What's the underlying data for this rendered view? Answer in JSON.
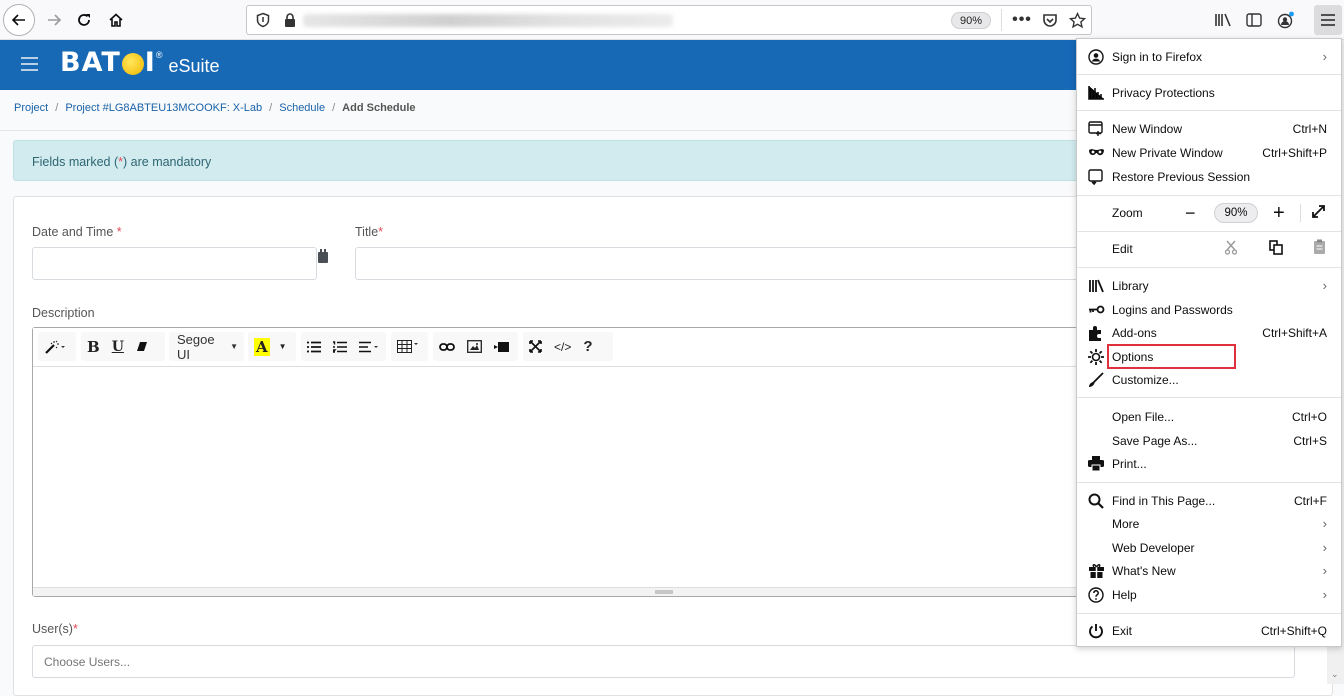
{
  "browser": {
    "zoom_badge": "90%",
    "icons": [
      "back-icon",
      "forward-icon",
      "reload-icon",
      "home-icon",
      "tracking-shield-icon",
      "lock-icon",
      "page-actions-icon",
      "pocket-icon",
      "bookmark-star-icon",
      "library-icon",
      "sidebar-icon",
      "account-icon",
      "hamburger-menu-icon"
    ]
  },
  "app": {
    "logo": "BATOI",
    "logo_reg": "®",
    "suite": "eSuite",
    "brand_color": "#1769b6"
  },
  "breadcrumb": [
    {
      "label": "Project"
    },
    {
      "label": "Project #LG8ABTEU13MCOOKF: X-Lab"
    },
    {
      "label": "Schedule"
    },
    {
      "label": "Add Schedule"
    }
  ],
  "alert": {
    "prefix": "Fields marked (",
    "star": "*",
    "suffix": ") are mandatory"
  },
  "form": {
    "date_label": "Date and Time ",
    "title_label": "Title",
    "description_label": "Description",
    "users_label": "User(s)",
    "required_mark": "*",
    "date_value": "",
    "title_value": "",
    "users_placeholder": "Choose Users..."
  },
  "editor": {
    "font_name": "Segoe UI",
    "help": "?",
    "code": "</>",
    "bold": "B",
    "underline": "U",
    "highlight": "A"
  },
  "menu": {
    "items": [
      {
        "label": "Sign in to Firefox",
        "shortcut": "",
        "arrow": true,
        "icon": "account-icon"
      },
      {
        "label": "Privacy Protections",
        "shortcut": "",
        "arrow": false,
        "icon": "privacy-chart-icon"
      },
      {
        "label": "New Window",
        "shortcut": "Ctrl+N",
        "arrow": false,
        "icon": "new-window-icon"
      },
      {
        "label": "New Private Window",
        "shortcut": "Ctrl+Shift+P",
        "arrow": false,
        "icon": "private-mask-icon"
      },
      {
        "label": "Restore Previous Session",
        "shortcut": "",
        "arrow": false,
        "icon": "restore-session-icon"
      },
      {
        "label": "Zoom",
        "value": "90%",
        "icon": ""
      },
      {
        "label": "Edit",
        "icon": ""
      },
      {
        "label": "Library",
        "shortcut": "",
        "arrow": true,
        "icon": "library-icon"
      },
      {
        "label": "Logins and Passwords",
        "shortcut": "",
        "arrow": false,
        "icon": "key-icon"
      },
      {
        "label": "Add-ons",
        "shortcut": "Ctrl+Shift+A",
        "arrow": false,
        "icon": "puzzle-icon"
      },
      {
        "label": "Options",
        "shortcut": "",
        "arrow": false,
        "icon": "gear-icon",
        "highlighted": true
      },
      {
        "label": "Customize...",
        "shortcut": "",
        "arrow": false,
        "icon": "brush-icon"
      },
      {
        "label": "Open File...",
        "shortcut": "Ctrl+O",
        "arrow": false,
        "icon": ""
      },
      {
        "label": "Save Page As...",
        "shortcut": "Ctrl+S",
        "arrow": false,
        "icon": ""
      },
      {
        "label": "Print...",
        "shortcut": "",
        "arrow": false,
        "icon": "printer-icon"
      },
      {
        "label": "Find in This Page...",
        "shortcut": "Ctrl+F",
        "arrow": false,
        "icon": "search-icon"
      },
      {
        "label": "More",
        "shortcut": "",
        "arrow": true,
        "icon": ""
      },
      {
        "label": "Web Developer",
        "shortcut": "",
        "arrow": true,
        "icon": ""
      },
      {
        "label": "What's New",
        "shortcut": "",
        "arrow": true,
        "icon": "gift-icon"
      },
      {
        "label": "Help",
        "shortcut": "",
        "arrow": true,
        "icon": "help-icon"
      },
      {
        "label": "Exit",
        "shortcut": "Ctrl+Shift+Q",
        "arrow": false,
        "icon": "power-icon"
      }
    ],
    "arrow_glyph": "›",
    "zoom_minus": "−",
    "zoom_plus": "+",
    "highlight_color": "#e0303b"
  }
}
